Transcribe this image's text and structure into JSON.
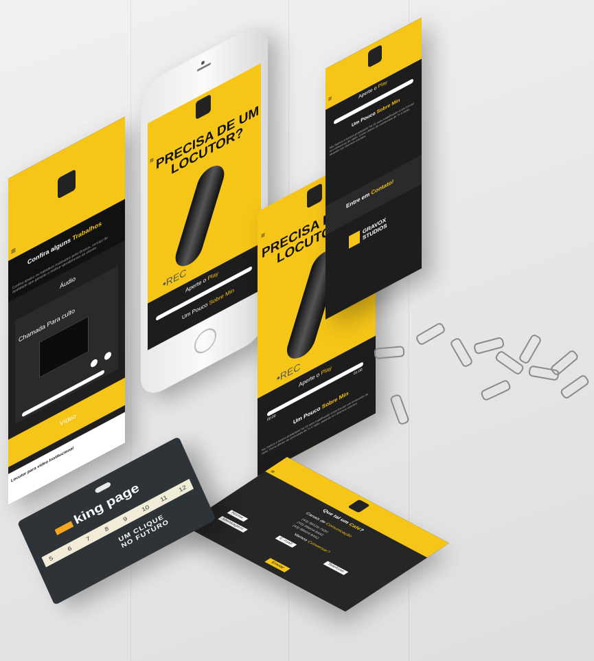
{
  "logo": {
    "line1": "GRAVOX",
    "line2": "STUDIOS"
  },
  "hero": {
    "line1": "PRECISA DE UM",
    "line2": "LOCUTOR?",
    "rec": "•REC"
  },
  "play_section": {
    "prefix": "Aperte o ",
    "highlight": "Play",
    "time_start": "00:00",
    "time_end": "01:00"
  },
  "about_section": {
    "prefix": "Um Pouco ",
    "highlight": "Sobre Min",
    "body": "Nio Santos é locutor publicitário há 15 anos trabalhando como locutor em emissoras de rádio. Como diretor de comerciais de Tv e rádio, atuando em diversos eventos."
  },
  "works": {
    "prefix": "Confira alguns ",
    "highlight": "Trabalhos",
    "intro": "Confira abaixo os trabalhos realizados pela Gravox, serviço de qualidade que garante o melhor atendimento ao cliente.",
    "audio_label": "Áudio",
    "track_title": "Chamada Para culto",
    "video_label": "Vídeo",
    "video_caption": "Locutor para vídeo Institucional"
  },
  "contact": {
    "prefix": "Que tal um ",
    "highlight": "Café",
    "suffix": "?",
    "channels_prefix": "Canais de ",
    "channels_highlight": "Comunicação",
    "phone1": "(43) 99126-7630",
    "phone2": "(43) 99604-9442",
    "phone3": "(43) 99604-9442",
    "talk_prefix": "Vamos ",
    "talk_highlight": "Conversar?",
    "name_label": "Nome:",
    "email_label": "E-mail:",
    "phone_label": "Telefone:",
    "message_label": "Mensagem:",
    "submit_label": "Enviar"
  },
  "right_screen": {
    "contact_prefix": "Entre em ",
    "contact_highlight": "Contato!"
  },
  "tag": {
    "brand": "king page",
    "slogan_line1": "UM CLIQUE",
    "slogan_line2": "NO FUTURO"
  },
  "ruler_numbers": [
    "5",
    "6",
    "7",
    "8",
    "9",
    "10",
    "11",
    "12"
  ],
  "colors": {
    "accent": "#f5c518",
    "dark": "#1d1d1d"
  }
}
